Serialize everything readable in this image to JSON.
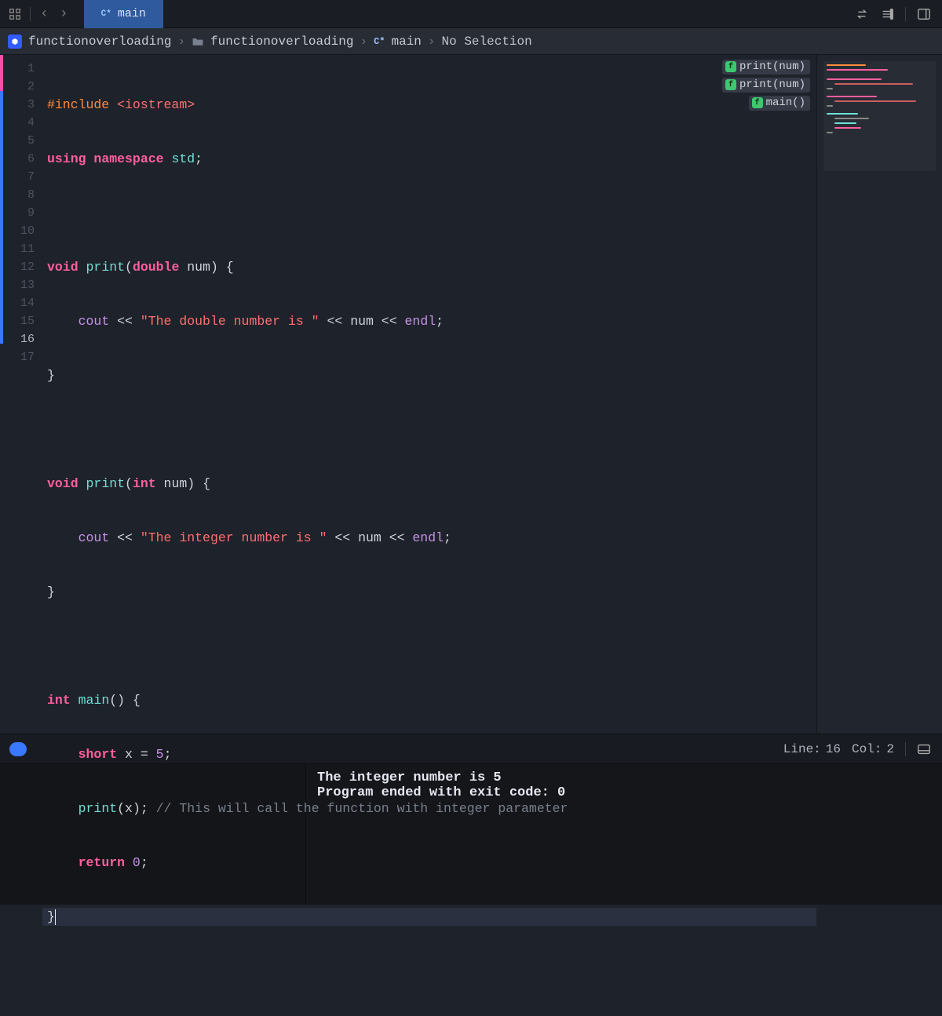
{
  "tab": {
    "lang": "C*",
    "title": "main"
  },
  "breadcrumb": {
    "project": "functionoverloading",
    "group": "functionoverloading",
    "file_lang": "C*",
    "file": "main",
    "selection": "No Selection"
  },
  "jumpbar": [
    {
      "badge": "f",
      "label": "print(num)"
    },
    {
      "badge": "f",
      "label": "print(num)"
    },
    {
      "badge": "f",
      "label": "main()"
    }
  ],
  "status": {
    "line_label": "Line:",
    "line": "16",
    "col_label": "Col:",
    "col": "2"
  },
  "console": {
    "line1": "The integer number is 5",
    "line2": "Program ended with exit code: 0"
  },
  "code": {
    "l1_a": "#include ",
    "l1_b": "<iostream>",
    "l2_a": "using ",
    "l2_b": "namespace ",
    "l2_c": "std",
    "l2_d": ";",
    "l4_a": "void ",
    "l4_b": "print",
    "l4_c": "(",
    "l4_d": "double ",
    "l4_e": "num",
    "l4_f": ") {",
    "l5_a": "    ",
    "l5_b": "cout",
    "l5_c": " << ",
    "l5_d": "\"The double number is \"",
    "l5_e": " << ",
    "l5_f": "num",
    "l5_g": " << ",
    "l5_h": "endl",
    "l5_i": ";",
    "l6": "}",
    "l8_a": "void ",
    "l8_b": "print",
    "l8_c": "(",
    "l8_d": "int ",
    "l8_e": "num",
    "l8_f": ") {",
    "l9_a": "    ",
    "l9_b": "cout",
    "l9_c": " << ",
    "l9_d": "\"The integer number is \"",
    "l9_e": " << ",
    "l9_f": "num",
    "l9_g": " << ",
    "l9_h": "endl",
    "l9_i": ";",
    "l10": "}",
    "l12_a": "int ",
    "l12_b": "main",
    "l12_c": "() {",
    "l13_a": "    ",
    "l13_b": "short ",
    "l13_c": "x",
    "l13_d": " = ",
    "l13_e": "5",
    "l13_f": ";",
    "l14_a": "    ",
    "l14_b": "print",
    "l14_c": "(",
    "l14_d": "x",
    "l14_e": "); ",
    "l14_f": "// This will call the function with integer parameter",
    "l15_a": "    ",
    "l15_b": "return ",
    "l15_c": "0",
    "l15_d": ";",
    "l16": "}"
  },
  "line_numbers": [
    "1",
    "2",
    "3",
    "4",
    "5",
    "6",
    "7",
    "8",
    "9",
    "10",
    "11",
    "12",
    "13",
    "14",
    "15",
    "16",
    "17"
  ]
}
